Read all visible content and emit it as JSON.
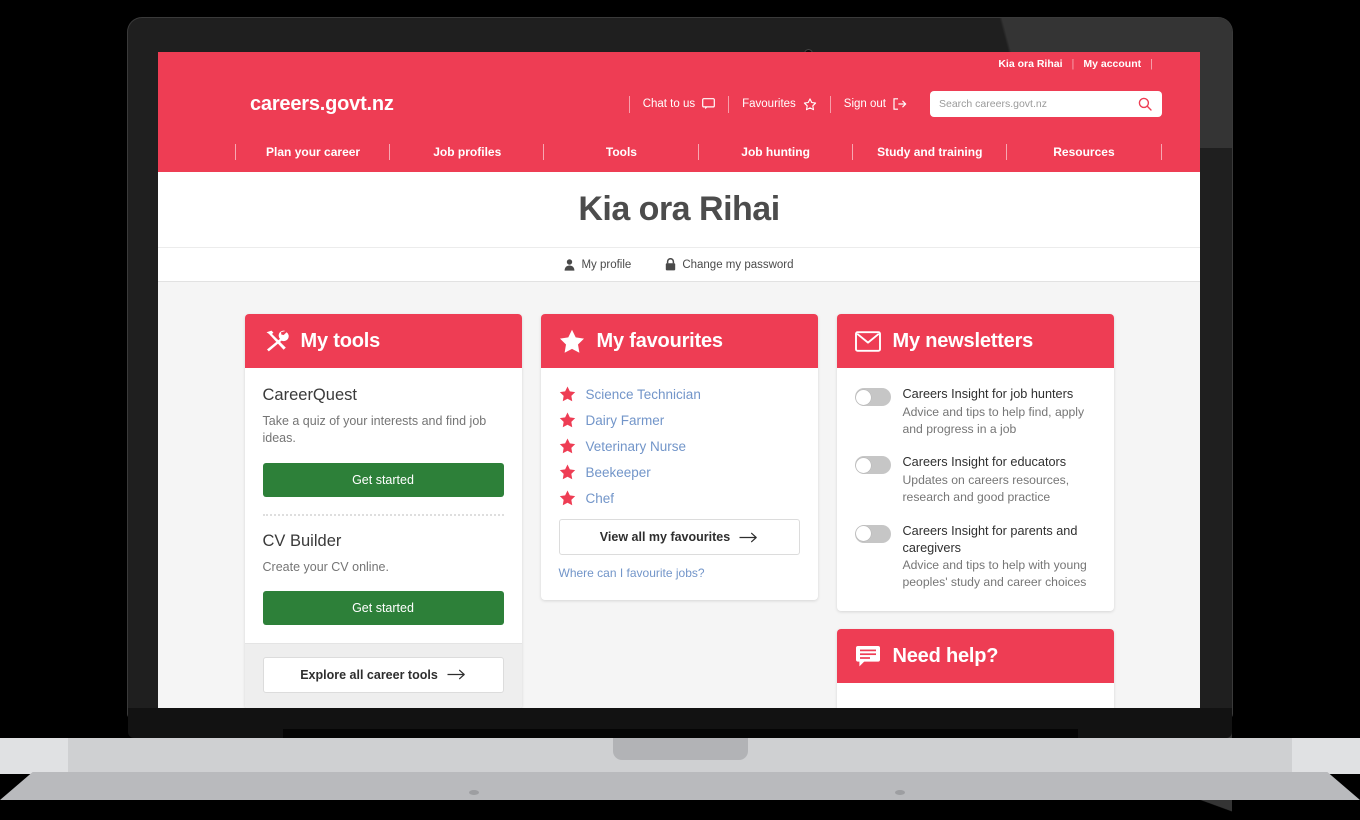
{
  "brand": {
    "red": "#ee3d54",
    "green": "#2d8039",
    "link_blue": "#7295c9",
    "logo": "careers.govt.nz"
  },
  "utility": {
    "greeting": "Kia ora Rihai",
    "account": "My account",
    "separator": "|"
  },
  "header": {
    "chat": "Chat to us",
    "favourites": "Favourites",
    "signout": "Sign out"
  },
  "search": {
    "placeholder": "Search careers.govt.nz",
    "value": ""
  },
  "nav": {
    "items": [
      {
        "label": "Plan your career"
      },
      {
        "label": "Job profiles"
      },
      {
        "label": "Tools"
      },
      {
        "label": "Job hunting"
      },
      {
        "label": "Study and training"
      },
      {
        "label": "Resources"
      }
    ]
  },
  "hero": {
    "title": "Kia ora Rihai"
  },
  "subnav": {
    "profile": "My profile",
    "password": "Change my password"
  },
  "tools_card": {
    "title": "My tools",
    "items": [
      {
        "name": "CareerQuest",
        "desc": "Take a quiz of your interests and find job ideas.",
        "button": "Get started"
      },
      {
        "name": "CV Builder",
        "desc": "Create your CV online.",
        "button": "Get started"
      }
    ],
    "footer_button": "Explore all career tools"
  },
  "favourites_card": {
    "title": "My favourites",
    "items": [
      {
        "label": "Science Technician"
      },
      {
        "label": "Dairy Farmer"
      },
      {
        "label": "Veterinary Nurse"
      },
      {
        "label": "Beekeeper"
      },
      {
        "label": "Chef"
      }
    ],
    "view_all": "View all my favourites",
    "footnote": "Where can I favourite jobs?"
  },
  "newsletters_card": {
    "title": "My newsletters",
    "items": [
      {
        "title": "Careers Insight for job hunters",
        "desc": "Advice and tips to help find, apply and progress in a job",
        "enabled": false
      },
      {
        "title": "Careers Insight for educators",
        "desc": "Updates on careers resources, research and good practice",
        "enabled": false
      },
      {
        "title": "Careers Insight for parents and caregivers",
        "desc": "Advice and tips to help with young peoples' study and career choices",
        "enabled": false
      }
    ]
  },
  "help_card": {
    "title": "Need help?"
  }
}
